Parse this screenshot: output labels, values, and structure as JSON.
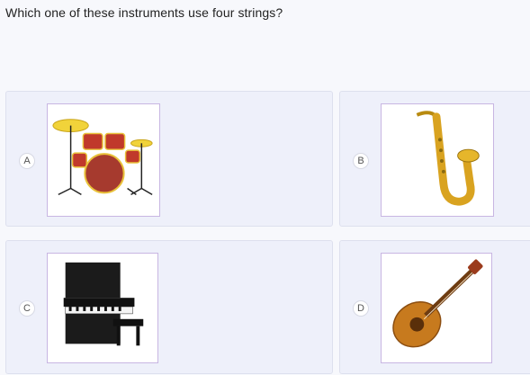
{
  "question": "Which one of these instruments use four strings?",
  "options": [
    {
      "letter": "A",
      "image": "drum-kit"
    },
    {
      "letter": "B",
      "image": "saxophone"
    },
    {
      "letter": "C",
      "image": "upright-piano"
    },
    {
      "letter": "D",
      "image": "acoustic-guitar"
    }
  ],
  "colors": {
    "card_bg": "#eef0fa",
    "image_border": "#c8b6e2"
  }
}
